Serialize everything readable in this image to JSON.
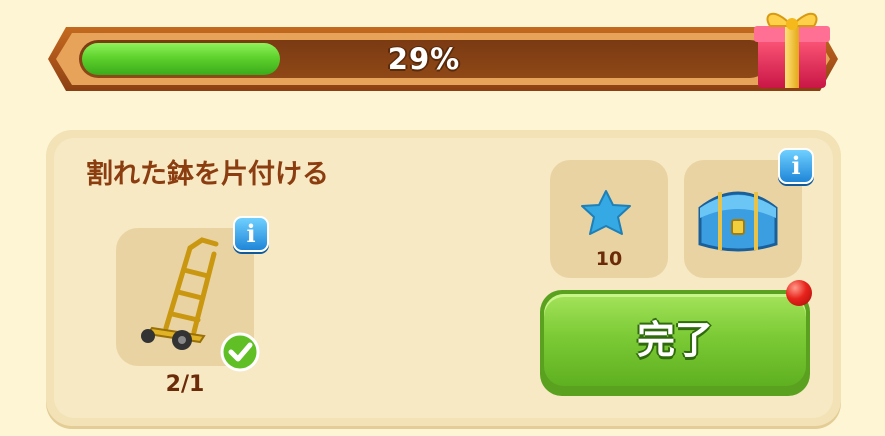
{
  "progress": {
    "percent_label": "29%",
    "value": 0.29,
    "fill_color": "#5fd22d"
  },
  "task": {
    "title": "割れた鉢を片付ける",
    "item": {
      "icon": "hand-truck-icon",
      "count": "2/1",
      "completed": true
    }
  },
  "rewards": [
    {
      "icon": "blue-star-icon",
      "amount": "10"
    },
    {
      "icon": "treasure-chest-icon"
    }
  ],
  "done_button": {
    "label": "完了",
    "color": "#7ccb36"
  },
  "icons": {
    "info": "i",
    "gift": "gift-box-icon",
    "check": "check-icon",
    "notification": "red-dot"
  }
}
